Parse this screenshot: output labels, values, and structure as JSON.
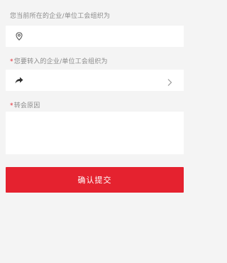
{
  "current_org": {
    "label": "您当前所在的企业/单位工会组织为",
    "icon": "location-pin-icon"
  },
  "target_org": {
    "required_mark": "*",
    "label": "您要转入的企业/单位工会组织为",
    "icon": "share-arrow-icon",
    "chevron_icon": "chevron-right-icon"
  },
  "reason": {
    "required_mark": "*",
    "label": "转会原因"
  },
  "actions": {
    "confirm_label": "确认提交"
  },
  "colors": {
    "accent": "#e5222f",
    "label_text": "#8a8a8a",
    "background": "#f4f4f4"
  }
}
